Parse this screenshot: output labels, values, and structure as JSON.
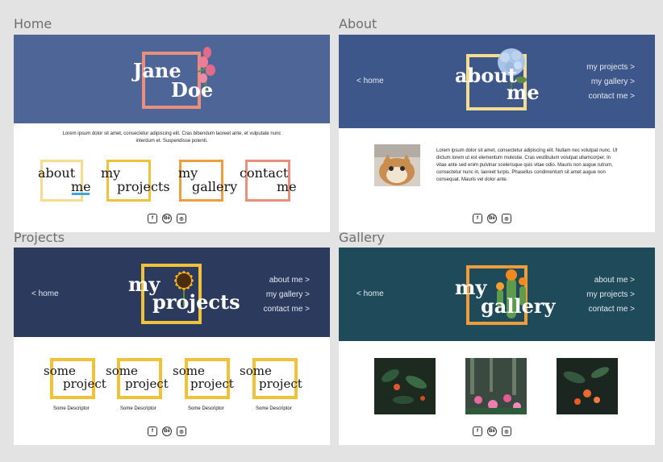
{
  "labels": {
    "home": "Home",
    "about": "About",
    "projects": "Projects",
    "gallery": "Gallery"
  },
  "colors": {
    "home_hero": "#4d6597",
    "about_hero": "#3d578a",
    "projects_hero": "#2c3a5e",
    "gallery_hero": "#1f4a5a",
    "yellow": "#f0c23a",
    "orange": "#ee9c3c",
    "salmon": "#e8907d",
    "pale_yellow": "#f5dd90"
  },
  "home": {
    "name_first": "Jane",
    "name_last": "Doe",
    "intro": "Lorem ipsum dolor sit amet, consectetur adipiscing elit. Cras bibendum laoreet ante, et vulputate nunc interdum et. Suspendisse potenti.",
    "tiles": [
      {
        "top": "about",
        "bottom": "me"
      },
      {
        "top": "my",
        "bottom": "projects"
      },
      {
        "top": "my",
        "bottom": "gallery"
      },
      {
        "top": "contact",
        "bottom": "me"
      }
    ]
  },
  "about": {
    "title_top": "about",
    "title_bottom": "me",
    "back": "< home",
    "nav": [
      "my projects >",
      "my gallery >",
      "contact me >"
    ],
    "bio": "Lorem ipsum dolor sit amet, consectetur adipiscing elit. Nullam nec volutpat nunc. Ut dictum lorem ut est elementum molestie. Cras vestibulum volutpat ullamcorper. In vitae ante sed enim pulvinar scelerisque quis vitae odio. Mauris non augue rutrum, consectetur nunc in, laoreet turpis. Phasellus condimentum sit amet augue non consequat. Mauris vel dolor ante."
  },
  "projects": {
    "title_top": "my",
    "title_bottom": "projects",
    "back": "< home",
    "nav": [
      "about me >",
      "my gallery >",
      "contact me >"
    ],
    "items": [
      {
        "top": "some",
        "bottom": "project",
        "desc": "Some Descriptor"
      },
      {
        "top": "some",
        "bottom": "project",
        "desc": "Some Descriptor"
      },
      {
        "top": "some",
        "bottom": "project",
        "desc": "Some Descriptor"
      },
      {
        "top": "some",
        "bottom": "project",
        "desc": "Some Descriptor"
      }
    ]
  },
  "gallery": {
    "title_top": "my",
    "title_bottom": "gallery",
    "back": "< home",
    "nav": [
      "about me >",
      "my projects >",
      "contact me >"
    ]
  },
  "social": {
    "facebook": "f",
    "behance": "Bē",
    "instagram": "◎"
  }
}
